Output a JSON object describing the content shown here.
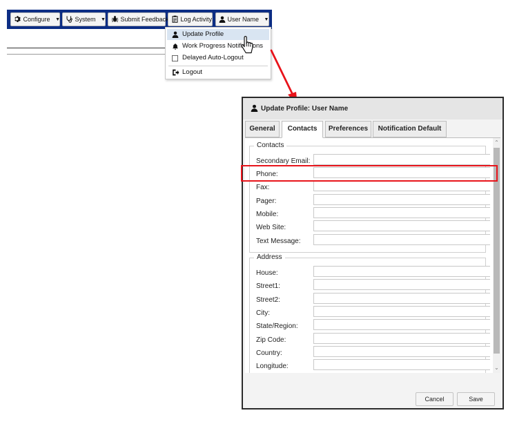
{
  "toolbar": {
    "configure_label": "Configure",
    "system_label": "System",
    "submit_feedback_label": "Submit Feedback",
    "log_activity_label": "Log Activity",
    "user_name_label": "User Name"
  },
  "user_menu": {
    "items": [
      {
        "label": "Update Profile",
        "icon": "user-icon"
      },
      {
        "label": "Work Progress Notifications",
        "icon": "bell-icon"
      },
      {
        "label": "Delayed Auto-Logout",
        "icon": "checkbox"
      },
      {
        "label": "Logout",
        "icon": "logout-icon"
      }
    ]
  },
  "dialog": {
    "title": "Update Profile: User Name",
    "tabs": [
      {
        "label": "General"
      },
      {
        "label": "Contacts"
      },
      {
        "label": "Preferences"
      },
      {
        "label": "Notification Default"
      }
    ],
    "active_tab": "Contacts",
    "contacts": {
      "legend": "Contacts",
      "fields": [
        {
          "label": "Secondary Email:",
          "value": ""
        },
        {
          "label": "Phone:",
          "value": ""
        },
        {
          "label": "Fax:",
          "value": ""
        },
        {
          "label": "Pager:",
          "value": ""
        },
        {
          "label": "Mobile:",
          "value": ""
        },
        {
          "label": "Web Site:",
          "value": ""
        },
        {
          "label": "Text Message:",
          "value": ""
        }
      ]
    },
    "address": {
      "legend": "Address",
      "fields": [
        {
          "label": "House:",
          "value": ""
        },
        {
          "label": "Street1:",
          "value": ""
        },
        {
          "label": "Street2:",
          "value": ""
        },
        {
          "label": "City:",
          "value": ""
        },
        {
          "label": "State/Region:",
          "value": ""
        },
        {
          "label": "Zip Code:",
          "value": ""
        },
        {
          "label": "Country:",
          "value": ""
        },
        {
          "label": "Longitude:",
          "value": ""
        }
      ]
    },
    "cancel_label": "Cancel",
    "save_label": "Save"
  },
  "colors": {
    "toolbar_bg": "#0c2d84",
    "highlight": "#e8131a",
    "menu_active_bg": "#d9e5f2"
  }
}
